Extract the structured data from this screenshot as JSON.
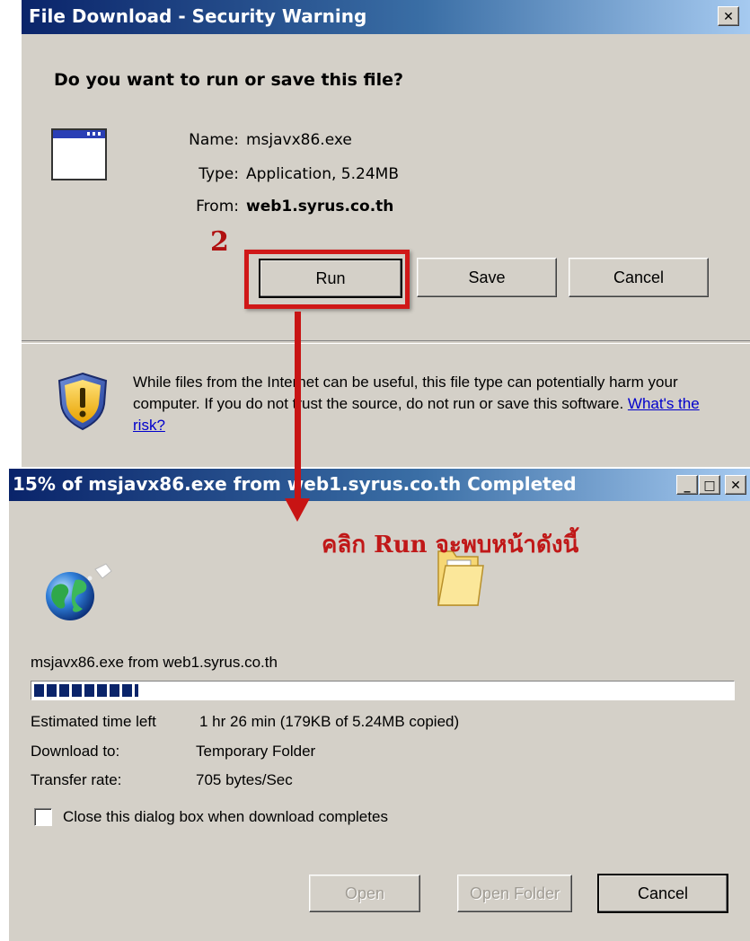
{
  "security_dialog": {
    "title": "File Download - Security Warning",
    "close_glyph": "✕",
    "question": "Do you want to run or save this file?",
    "name_label": "Name:",
    "name_value": "msjavx86.exe",
    "type_label": "Type:",
    "type_value": "Application, 5.24MB",
    "from_label": "From:",
    "from_value": "web1.syrus.co.th",
    "run_button": "Run",
    "save_button": "Save",
    "cancel_button": "Cancel",
    "warning_text": "While files from the Internet can be useful, this file type can potentially harm your computer. If you do not trust the source, do not run or save this software. ",
    "risk_link": "What's the risk?"
  },
  "annotation": {
    "step_number": "2",
    "caption": "คลิก Run จะพบหน้าดังนี้",
    "color": "#c81414"
  },
  "download_dialog": {
    "title": "15% of msjavx86.exe from web1.syrus.co.th Completed",
    "minimize_glyph": "_",
    "maximize_glyph": "□",
    "close_glyph": "✕",
    "source_line": "msjavx86.exe from web1.syrus.co.th",
    "progress_fraction": 0.15,
    "estimated_label": "Estimated time left",
    "estimated_value": "1 hr 26 min (179KB of 5.24MB copied)",
    "download_to_label": "Download to:",
    "download_to_value": "Temporary Folder",
    "transfer_rate_label": "Transfer rate:",
    "transfer_rate_value": "705 bytes/Sec",
    "close_when_done_label": "Close this dialog box when download completes",
    "close_when_done_checked": false,
    "open_button": "Open",
    "open_folder_button": "Open Folder",
    "cancel_button": "Cancel"
  },
  "icons": {
    "app_icon": "application-window-icon",
    "shield_icon": "security-shield-icon",
    "globe_icon": "globe-icon",
    "folder_icon": "folder-icon"
  },
  "colors": {
    "title_gradient_start": "#0a246a",
    "title_gradient_end": "#a6caf0",
    "dialog_face": "#d4d0c8",
    "link": "#0000cc"
  }
}
